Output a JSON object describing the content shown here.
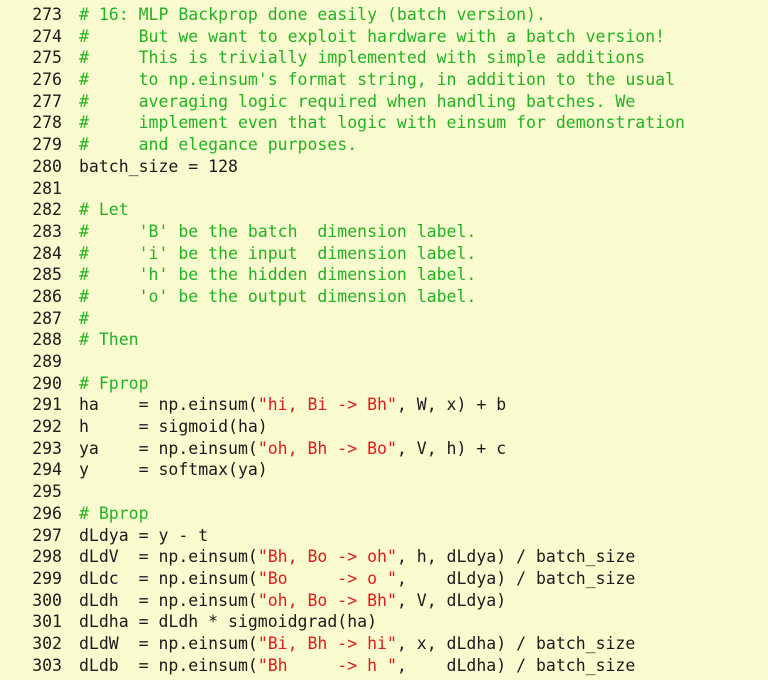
{
  "editor": {
    "background_color": "#fbfbd0",
    "comment_color": "#22b222",
    "string_color": "#e01b1b",
    "text_color": "#1a1a1a",
    "first_line_number": 273,
    "last_line_number": 303
  },
  "lines": [
    {
      "number": "273",
      "tokens": [
        {
          "t": "comment",
          "s": "# 16: MLP Backprop done easily (batch version)."
        }
      ]
    },
    {
      "number": "274",
      "tokens": [
        {
          "t": "comment",
          "s": "#     But we want to exploit hardware with a batch version!"
        }
      ]
    },
    {
      "number": "275",
      "tokens": [
        {
          "t": "comment",
          "s": "#     This is trivially implemented with simple additions"
        }
      ]
    },
    {
      "number": "276",
      "tokens": [
        {
          "t": "comment",
          "s": "#     to np.einsum's format string, in addition to the usual"
        }
      ]
    },
    {
      "number": "277",
      "tokens": [
        {
          "t": "comment",
          "s": "#     averaging logic required when handling batches. We"
        }
      ]
    },
    {
      "number": "278",
      "tokens": [
        {
          "t": "comment",
          "s": "#     implement even that logic with einsum for demonstration"
        }
      ]
    },
    {
      "number": "279",
      "tokens": [
        {
          "t": "comment",
          "s": "#     and elegance purposes."
        }
      ]
    },
    {
      "number": "280",
      "tokens": [
        {
          "t": "plain",
          "s": "batch_size = 128"
        }
      ]
    },
    {
      "number": "281",
      "tokens": [
        {
          "t": "plain",
          "s": ""
        }
      ]
    },
    {
      "number": "282",
      "tokens": [
        {
          "t": "comment",
          "s": "# Let"
        }
      ]
    },
    {
      "number": "283",
      "tokens": [
        {
          "t": "comment",
          "s": "#     'B' be the batch  dimension label."
        }
      ]
    },
    {
      "number": "284",
      "tokens": [
        {
          "t": "comment",
          "s": "#     'i' be the input  dimension label."
        }
      ]
    },
    {
      "number": "285",
      "tokens": [
        {
          "t": "comment",
          "s": "#     'h' be the hidden dimension label."
        }
      ]
    },
    {
      "number": "286",
      "tokens": [
        {
          "t": "comment",
          "s": "#     'o' be the output dimension label."
        }
      ]
    },
    {
      "number": "287",
      "tokens": [
        {
          "t": "comment",
          "s": "#"
        }
      ]
    },
    {
      "number": "288",
      "tokens": [
        {
          "t": "comment",
          "s": "# Then"
        }
      ]
    },
    {
      "number": "289",
      "tokens": [
        {
          "t": "plain",
          "s": ""
        }
      ]
    },
    {
      "number": "290",
      "tokens": [
        {
          "t": "comment",
          "s": "# Fprop"
        }
      ]
    },
    {
      "number": "291",
      "tokens": [
        {
          "t": "plain",
          "s": "ha    = np.einsum("
        },
        {
          "t": "string",
          "s": "\"hi, Bi -> Bh\""
        },
        {
          "t": "plain",
          "s": ", W, x) + b"
        }
      ]
    },
    {
      "number": "292",
      "tokens": [
        {
          "t": "plain",
          "s": "h     = sigmoid(ha)"
        }
      ]
    },
    {
      "number": "293",
      "tokens": [
        {
          "t": "plain",
          "s": "ya    = np.einsum("
        },
        {
          "t": "string",
          "s": "\"oh, Bh -> Bo\""
        },
        {
          "t": "plain",
          "s": ", V, h) + c"
        }
      ]
    },
    {
      "number": "294",
      "tokens": [
        {
          "t": "plain",
          "s": "y     = softmax(ya)"
        }
      ]
    },
    {
      "number": "295",
      "tokens": [
        {
          "t": "plain",
          "s": ""
        }
      ]
    },
    {
      "number": "296",
      "tokens": [
        {
          "t": "comment",
          "s": "# Bprop"
        }
      ]
    },
    {
      "number": "297",
      "tokens": [
        {
          "t": "plain",
          "s": "dLdya = y - t"
        }
      ]
    },
    {
      "number": "298",
      "tokens": [
        {
          "t": "plain",
          "s": "dLdV  = np.einsum("
        },
        {
          "t": "string",
          "s": "\"Bh, Bo -> oh\""
        },
        {
          "t": "plain",
          "s": ", h, dLdya) / batch_size"
        }
      ]
    },
    {
      "number": "299",
      "tokens": [
        {
          "t": "plain",
          "s": "dLdc  = np.einsum("
        },
        {
          "t": "string",
          "s": "\"Bo     -> o \""
        },
        {
          "t": "plain",
          "s": ",    dLdya) / batch_size"
        }
      ]
    },
    {
      "number": "300",
      "tokens": [
        {
          "t": "plain",
          "s": "dLdh  = np.einsum("
        },
        {
          "t": "string",
          "s": "\"oh, Bo -> Bh\""
        },
        {
          "t": "plain",
          "s": ", V, dLdya)"
        }
      ]
    },
    {
      "number": "301",
      "tokens": [
        {
          "t": "plain",
          "s": "dLdha = dLdh * sigmoidgrad(ha)"
        }
      ]
    },
    {
      "number": "302",
      "tokens": [
        {
          "t": "plain",
          "s": "dLdW  = np.einsum("
        },
        {
          "t": "string",
          "s": "\"Bi, Bh -> hi\""
        },
        {
          "t": "plain",
          "s": ", x, dLdha) / batch_size"
        }
      ]
    },
    {
      "number": "303",
      "tokens": [
        {
          "t": "plain",
          "s": "dLdb  = np.einsum("
        },
        {
          "t": "string",
          "s": "\"Bh     -> h \""
        },
        {
          "t": "plain",
          "s": ",    dLdha) / batch_size"
        }
      ]
    }
  ]
}
